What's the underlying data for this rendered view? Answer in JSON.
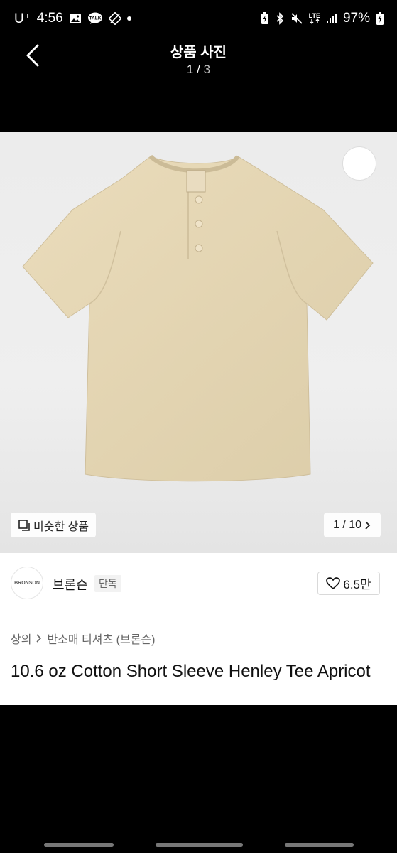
{
  "status": {
    "carrier": "U⁺",
    "time": "4:56",
    "kakao_badge": "TALK",
    "network": "LTE",
    "battery": "97%"
  },
  "header": {
    "title": "상품 사진",
    "current": "1",
    "separator": "/",
    "total": "3"
  },
  "gallery": {
    "similar_label": "비슷한 상품",
    "image_counter": "1 / 10",
    "shirt_color": "#e6d8b5"
  },
  "product": {
    "brand_name": "브론슨",
    "brand_logo_text": "BRONSON",
    "exclusive_badge": "단독",
    "likes": "6.5만",
    "category_main": "상의",
    "category_sub": "반소매 티셔츠 (브론슨)",
    "title": "10.6 oz Cotton Short Sleeve Henley Tee Apricot"
  }
}
